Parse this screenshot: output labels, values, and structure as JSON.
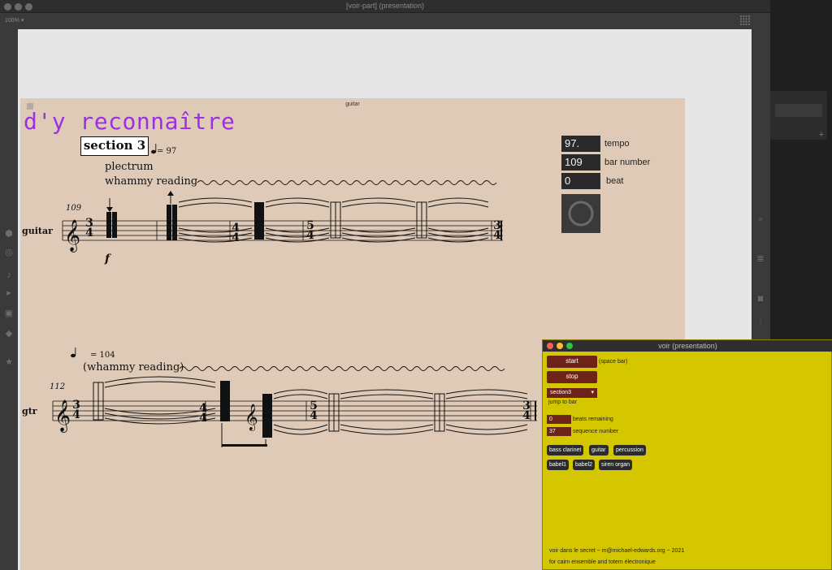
{
  "main_window": {
    "title": "[voir-part] (presentation)",
    "zoom": "100% ▾"
  },
  "score": {
    "panel_title": "guitar",
    "piece_title": "d'y reconnaître",
    "section_label": "section 3",
    "tempo_1": "= 97",
    "tempo_2": "= 104",
    "technique_1": "plectrum",
    "technique_2": "whammy reading",
    "technique_3": "(whammy reading)",
    "bar_number_1": "109",
    "bar_number_2": "112",
    "instrument_1": "guitar",
    "instrument_2": "gtr",
    "dynamic": "f",
    "time_sigs_row1": [
      [
        "3",
        "4"
      ],
      [
        "4",
        "4"
      ],
      [
        "5",
        "4"
      ],
      [
        "3",
        "4"
      ]
    ],
    "time_sigs_row2": [
      [
        "3",
        "4"
      ],
      [
        "4",
        "4"
      ],
      [
        "5",
        "4"
      ],
      [
        "3",
        "4"
      ]
    ]
  },
  "readouts": {
    "tempo_value": "97.",
    "tempo_label": "tempo",
    "bar_value": "109",
    "bar_label": "bar number",
    "beat_value": "0",
    "beat_label": "beat"
  },
  "voir_window": {
    "title": "voir (presentation)",
    "start_label": "start",
    "start_hint": "(space bar)",
    "stop_label": "stop",
    "section_selected": "section3",
    "jump_label": "jump to bar",
    "beats_value": "0",
    "beats_label": "beats remaining",
    "seq_value": "37",
    "seq_label": "sequence number",
    "parts_row1": [
      "bass clarinet",
      "guitar",
      "percussion"
    ],
    "parts_row2": [
      "babel1",
      "babel2",
      "siren organ"
    ],
    "credit_1": "voir dans le secret ~ m@michael-edwards.org ~ 2021",
    "credit_2": "for cairn ensemble and totem électronique"
  },
  "colors": {
    "title_purple": "#9b30e0",
    "score_bg": "#dfcab7",
    "voir_bg": "#d4c700",
    "button_red": "#6e2318"
  }
}
